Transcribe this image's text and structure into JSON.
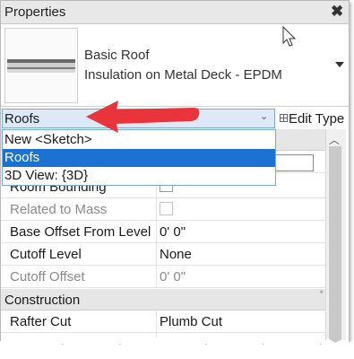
{
  "panel": {
    "title": "Properties",
    "close_glyph": "✖"
  },
  "type_selector": {
    "family": "Basic Roof",
    "type_name": "Insulation on Metal Deck - EPDM"
  },
  "instance_filter": {
    "selected": "Roofs",
    "edit_type_label": "Edit Type"
  },
  "dropdown": {
    "items": [
      "New <Sketch>",
      "Roofs",
      "3D View: {3D}"
    ],
    "selected_index": 1
  },
  "properties": {
    "rows": [
      {
        "label": "Room Bounding",
        "value": ""
      },
      {
        "label": "Related to Mass",
        "value": ""
      },
      {
        "label": "Base Offset From Level",
        "value": "0'  0\""
      },
      {
        "label": "Cutoff Level",
        "value": "None"
      },
      {
        "label": "Cutoff Offset",
        "value": "0'  0\""
      }
    ],
    "group_construction": "Construction",
    "construction_rows": [
      {
        "label": "Rafter Cut",
        "value": "Plumb Cut"
      }
    ]
  },
  "colors": {
    "selection": "#1a73d1",
    "annotation_arrow": "#e8343a",
    "group_bg": "#e6e6e6"
  },
  "icons": [
    "close-icon",
    "roof-thumbnail",
    "mouse-cursor-icon",
    "chevron-down-icon",
    "edit-type-icon",
    "scroll-up-icon",
    "annotation-arrow"
  ]
}
